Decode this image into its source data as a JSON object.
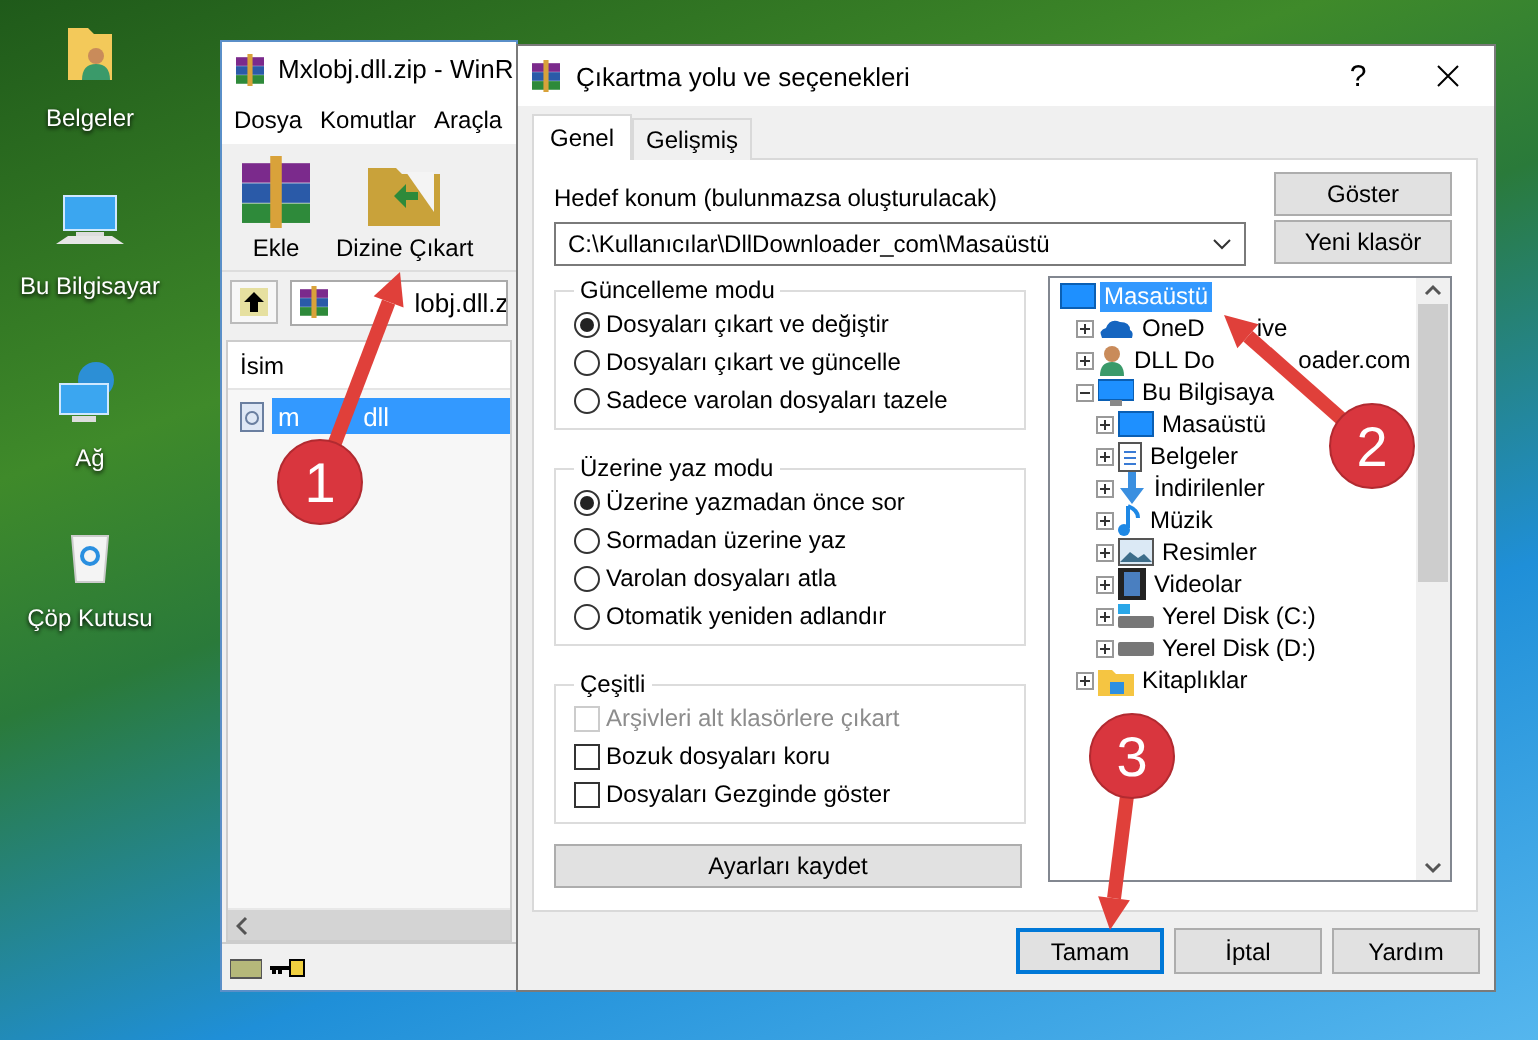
{
  "desktop_icons": [
    {
      "label": "Belgeler"
    },
    {
      "label": "Bu Bilgisayar"
    },
    {
      "label": "Ağ"
    },
    {
      "label": "Çöp Kutusu"
    }
  ],
  "winrar": {
    "title": "Mxlobj.dll.zip - WinR",
    "menu": [
      "Dosya",
      "Komutlar",
      "Araçla"
    ],
    "toolbar": [
      {
        "label": "Ekle"
      },
      {
        "label": "Dizine Çıkart"
      }
    ],
    "address": "lobj.dll.z",
    "column": "İsim",
    "files": [
      {
        "name_parts": [
          "m",
          "dll"
        ],
        "selected": true
      }
    ]
  },
  "dialog": {
    "title": "Çıkartma yolu ve seçenekleri",
    "help": "?",
    "tabs": [
      {
        "label": "Genel",
        "selected": true
      },
      {
        "label": "Gelişmiş",
        "selected": false
      }
    ],
    "destination": {
      "label": "Hedef konum (bulunmazsa oluşturulacak)",
      "value": "C:\\Kullanıcılar\\DllDownloader_com\\Masaüstü"
    },
    "side_buttons": [
      "Göster",
      "Yeni klasör"
    ],
    "groups": [
      {
        "title": "Güncelleme modu",
        "kind": "radio",
        "options": [
          {
            "label": "Dosyaları çıkart ve değiştir",
            "selected": true
          },
          {
            "label": "Dosyaları çıkart ve güncelle",
            "selected": false
          },
          {
            "label": "Sadece varolan dosyaları tazele",
            "selected": false
          }
        ]
      },
      {
        "title": "Üzerine yaz modu",
        "kind": "radio",
        "options": [
          {
            "label": "Üzerine yazmadan önce sor",
            "selected": true
          },
          {
            "label": "Sormadan üzerine yaz",
            "selected": false
          },
          {
            "label": "Varolan dosyaları atla",
            "selected": false
          },
          {
            "label": "Otomatik yeniden adlandır",
            "selected": false
          }
        ]
      },
      {
        "title": "Çeşitli",
        "kind": "checkbox",
        "options": [
          {
            "label": "Arşivleri alt klasörlere çıkart",
            "checked": false,
            "disabled": true
          },
          {
            "label": "Bozuk dosyaları koru",
            "checked": false,
            "disabled": false
          },
          {
            "label": "Dosyaları Gezginde göster",
            "checked": false,
            "disabled": false
          }
        ]
      }
    ],
    "save_button": "Ayarları kaydet",
    "tree": [
      {
        "label": "Masaüstü",
        "selected": true,
        "children": [
          {
            "label_parts": [
              "OneD",
              "ive"
            ],
            "selected": false,
            "expanded": false
          },
          {
            "label_parts": [
              "DLL Do",
              "oader.com"
            ],
            "selected": false,
            "expanded": false
          },
          {
            "label": "Bu Bilgisaya",
            "selected": false,
            "expanded": true,
            "children": [
              {
                "label": "Masaüstü",
                "selected": false,
                "expanded": false
              },
              {
                "label": "Belgeler",
                "selected": false,
                "expanded": false
              },
              {
                "label": "İndirilenler",
                "selected": false,
                "expanded": false
              },
              {
                "label": "Müzik",
                "selected": false,
                "expanded": false
              },
              {
                "label": "Resimler",
                "selected": false,
                "expanded": false
              },
              {
                "label": "Videolar",
                "selected": false,
                "expanded": false
              },
              {
                "label": "Yerel Disk (C:)",
                "selected": false,
                "expanded": false
              },
              {
                "label": "Yerel Disk (D:)",
                "selected": false,
                "expanded": false
              }
            ]
          },
          {
            "label": "Kitaplıklar",
            "selected": false,
            "expanded": false
          }
        ]
      }
    ],
    "buttons": [
      {
        "label": "Tamam",
        "focused": true
      },
      {
        "label": "İptal",
        "focused": false
      },
      {
        "label": "Yardım",
        "focused": false
      }
    ]
  },
  "annotations": [
    {
      "number": "1"
    },
    {
      "number": "2"
    },
    {
      "number": "3"
    }
  ]
}
